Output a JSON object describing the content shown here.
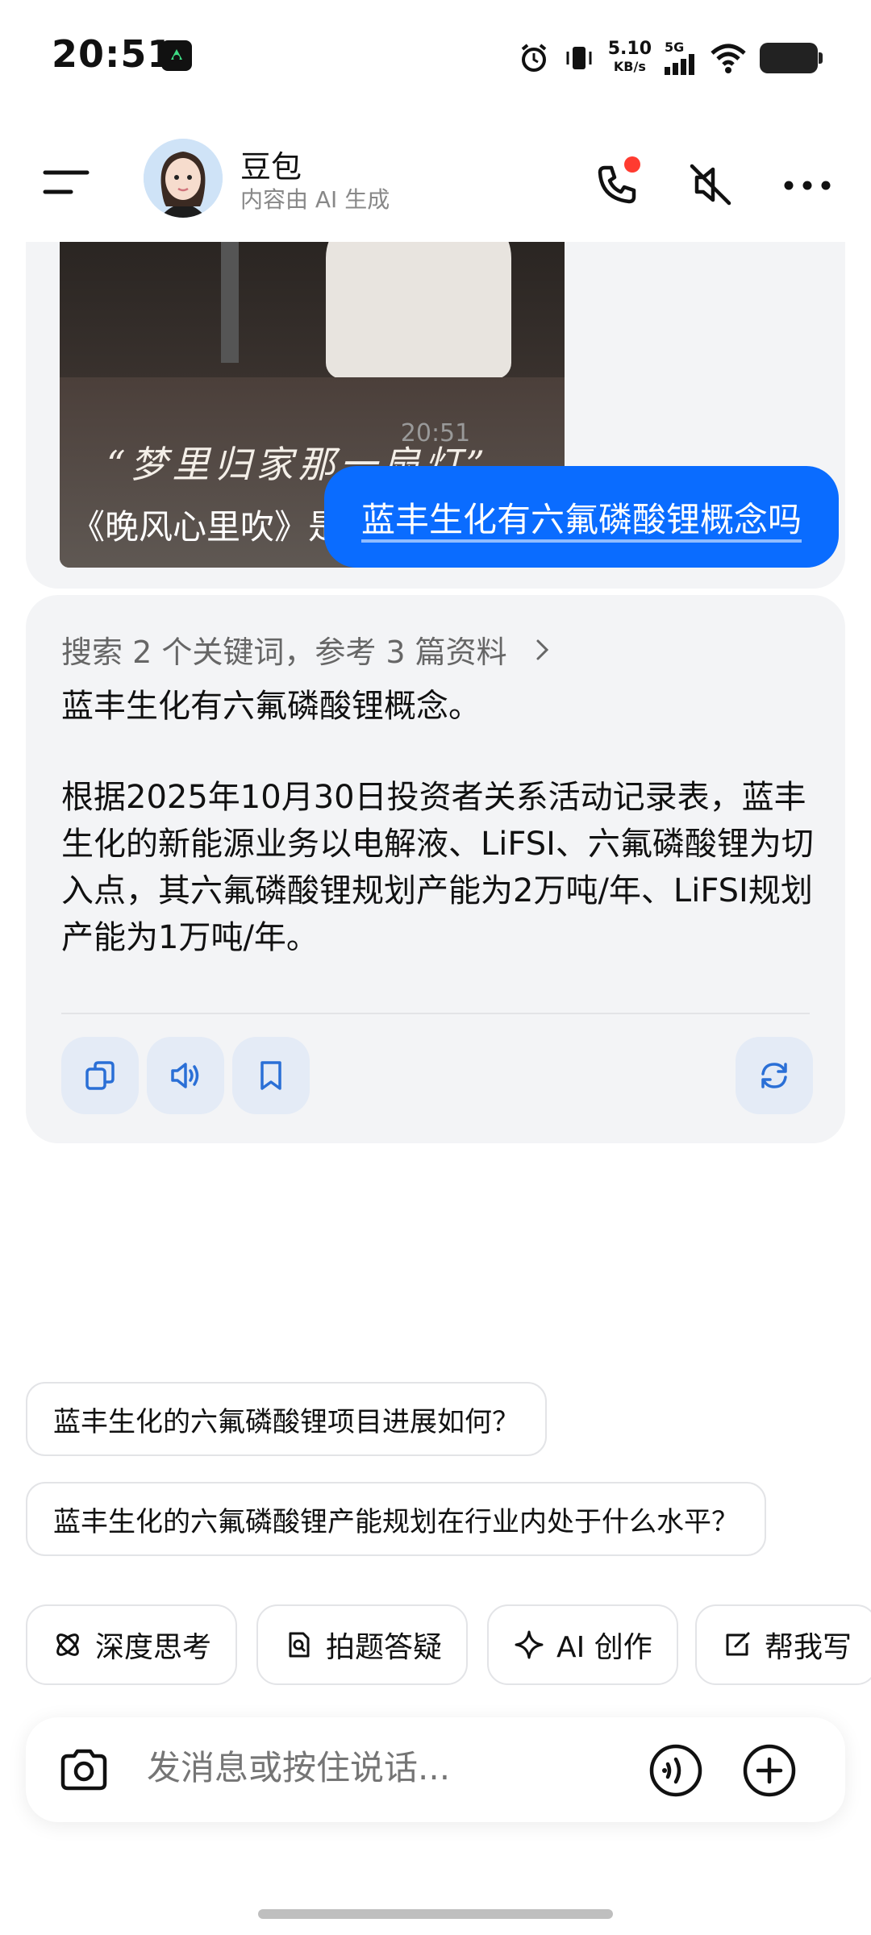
{
  "status_bar": {
    "time": "20:51",
    "net_speed": "5.10",
    "net_unit": "KB/s",
    "network": "5G"
  },
  "header": {
    "bot_name": "豆包",
    "bot_subtitle": "内容由 AI 生成"
  },
  "previous_card": {
    "calligraphy": "“梦里归家那一扇灯”",
    "video_title": "《晚风心里吹》是由邓澄、…"
  },
  "chat": {
    "timestamp": "20:51",
    "user_message": "蓝丰生化有六氟磷酸锂概念吗",
    "answer": {
      "search_summary": "搜索 2 个关键词，参考 3 篇资料",
      "paragraph1": "蓝丰生化有六氟磷酸锂概念。",
      "paragraph2": "根据2025年10月30日投资者关系活动记录表，蓝丰生化的新能源业务以电解液、LiFSI、六氟磷酸锂为切入点，其六氟磷酸锂规划产能为2万吨/年、LiFSI规划产能为1万吨/年。"
    },
    "suggestions": [
      "蓝丰生化的六氟磷酸锂项目进展如何？",
      "蓝丰生化的六氟磷酸锂产能规划在行业内处于什么水平？"
    ]
  },
  "tools": [
    "深度思考",
    "拍题答疑",
    "AI 创作",
    "帮我写"
  ],
  "input": {
    "placeholder": "发消息或按住说话..."
  },
  "colors": {
    "accent": "#0a6cff",
    "card_bg": "#f3f4f6",
    "action_bg": "#e4ebf6",
    "icon_blue": "#2a6fd6"
  }
}
